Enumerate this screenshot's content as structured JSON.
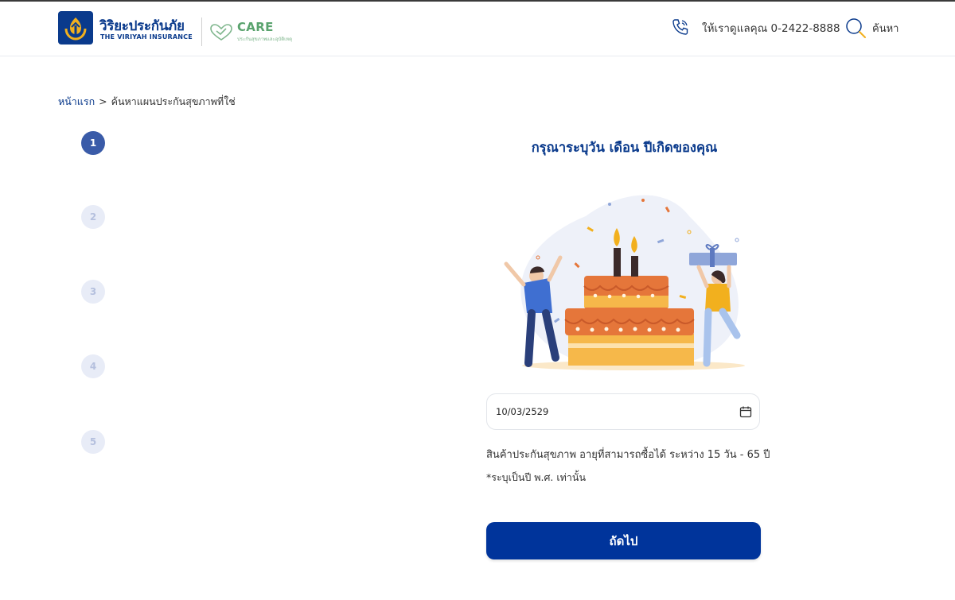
{
  "header": {
    "brand_th": "วิริยะประกันภัย",
    "brand_en": "THE VIRIYAH INSURANCE",
    "care_title": "CARE",
    "care_subtitle": "ประกันสุขภาพและอุบัติเหตุ",
    "contact_text": "ให้เราดูแลคุณ 0-2422-8888",
    "search_label": "ค้นหา",
    "brand_color": "#0a3a8c",
    "care_color": "#5aa36e"
  },
  "breadcrumb": {
    "home": "หน้าแรก",
    "separator": ">",
    "current": "ค้นหาแผนประกันสุขภาพที่ใช่"
  },
  "steps": [
    {
      "number": "1",
      "active": true
    },
    {
      "number": "2",
      "active": false
    },
    {
      "number": "3",
      "active": false
    },
    {
      "number": "4",
      "active": false
    },
    {
      "number": "5",
      "active": false
    }
  ],
  "form": {
    "title": "กรุณาระบุวัน เดือน ปีเกิดของคุณ",
    "date_value": "10/03/2529",
    "info_line1": "สินค้าประกันสุขภาพ อายุที่สามารถซื้อได้ ระหว่าง 15 วัน - 65 ปี",
    "info_line2": "*ระบุเป็นปี พ.ศ. เท่านั้น",
    "next_label": "ถัดไป",
    "button_color": "#00349b"
  },
  "icons": {
    "phone": "phone-icon",
    "search": "search-icon",
    "calendar": "calendar-icon",
    "heart": "heart-shield-icon"
  }
}
